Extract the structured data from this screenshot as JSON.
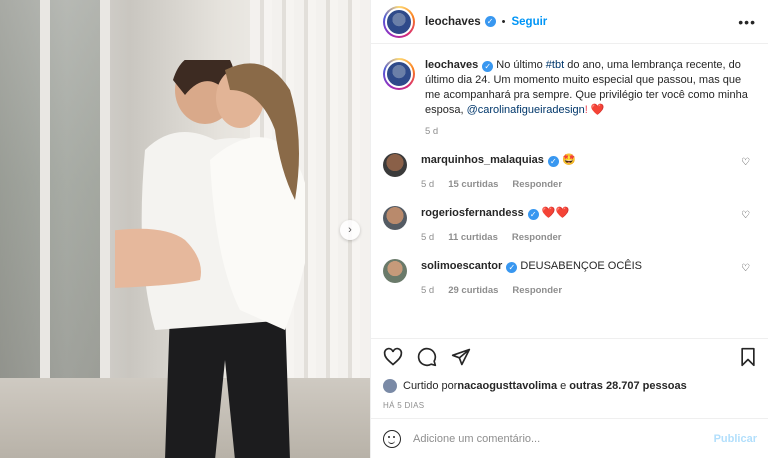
{
  "post": {
    "author": "leochaves",
    "follow_label": "Seguir",
    "more_icon": "more-icon"
  },
  "caption": {
    "username": "leochaves",
    "text_before_hashtag": " No último ",
    "hashtag": "#tbt",
    "text_after_hashtag": " do ano, uma lembrança recente, do último dia 24. Um momento muito especial que passou, mas que me acompanhará pra sempre. Que privilégio ter você como minha esposa, ",
    "mention": "@carolinafigueiradesign",
    "end": "! ❤️",
    "time": "5 d"
  },
  "comments": [
    {
      "username": "marquinhos_malaquias",
      "text": "🤩",
      "time": "5 d",
      "likes": "15 curtidas",
      "reply": "Responder"
    },
    {
      "username": "rogeriosfernandess",
      "text": "❤️❤️",
      "time": "5 d",
      "likes": "11 curtidas",
      "reply": "Responder"
    },
    {
      "username": "solimoescantor",
      "text": "DEUSABENÇOE OCÊIS",
      "time": "5 d",
      "likes": "29 curtidas",
      "reply": "Responder"
    }
  ],
  "likes": {
    "prefix": "Curtido por ",
    "user": "nacaogusttavolima",
    "middle": " e ",
    "others": "outras 28.707 pessoas"
  },
  "posted_ago": "HÁ 5 DIAS",
  "add_comment": {
    "placeholder": "Adicione um comentário...",
    "publish_label": "Publicar"
  },
  "colors": {
    "accent": "#0095f6",
    "verified": "#3897f0",
    "publish_disabled": "#b2dffc",
    "secondary_text": "#8e8e8e"
  }
}
